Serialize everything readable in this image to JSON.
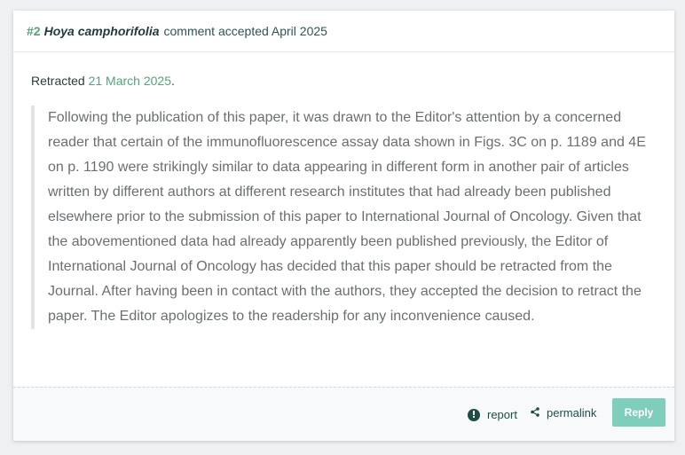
{
  "header": {
    "number": "#2",
    "species": "Hoya camphorifolia",
    "status": "comment accepted April 2025"
  },
  "retraction": {
    "prefix": "Retracted",
    "date": "21 March 2025",
    "suffix": "."
  },
  "notice": {
    "text": "Following the publication of this paper, it was drawn to the Editor's attention by a concerned reader that certain of the immunofluorescence assay data shown in Figs. 3C on p. 1189 and 4E on p. 1190 were strikingly similar to data appearing in different form in another pair of articles written by different authors at different research institutes that had already been published elsewhere prior to the submission of this paper to International Journal of Oncology. Given that the abovementioned data had already apparently been published previously, the Editor of International Journal of Oncology has decided that this paper should be retracted from the Journal. After having been in contact with the authors, they accepted the decision to retract the paper. The Editor apologizes to the readership for any inconvenience caused."
  },
  "footer": {
    "report_label": "report",
    "report_icon": "exclamation-circle-icon",
    "permalink_label": "permalink",
    "permalink_icon": "share-icon",
    "reply_label": "Reply"
  },
  "colors": {
    "accent_green": "#55a27a",
    "reply_button": "#7fcdbb",
    "dark_teal": "#1f4d47",
    "quote_text": "#6b6f72"
  }
}
